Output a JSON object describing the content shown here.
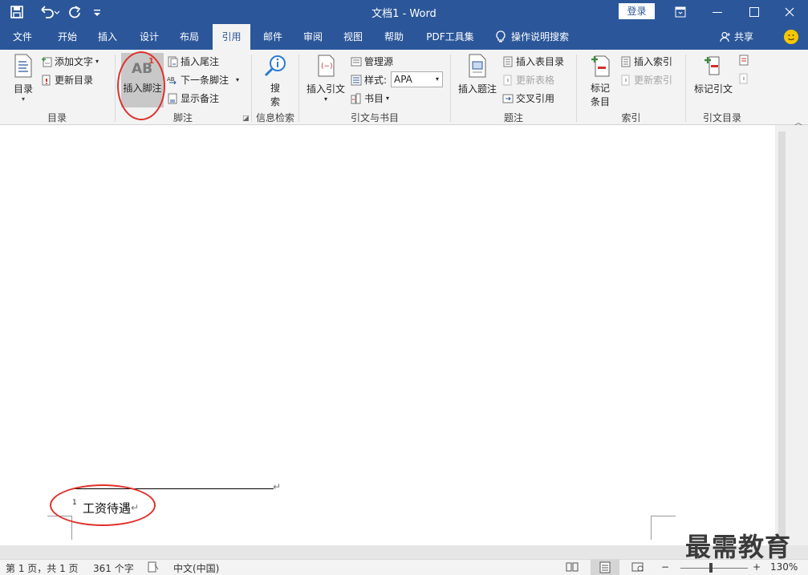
{
  "window": {
    "title": "文档1  -  Word",
    "login_label": "登录"
  },
  "tabs": [
    {
      "label": "文件"
    },
    {
      "label": "开始"
    },
    {
      "label": "插入"
    },
    {
      "label": "设计"
    },
    {
      "label": "布局"
    },
    {
      "label": "引用"
    },
    {
      "label": "邮件"
    },
    {
      "label": "审阅"
    },
    {
      "label": "视图"
    },
    {
      "label": "帮助"
    },
    {
      "label": "PDF工具集"
    }
  ],
  "active_tab": "引用",
  "tell_me": "操作说明搜索",
  "share": "共享",
  "ribbon": {
    "toc": {
      "big": "目录",
      "add_text": "添加文字",
      "update_toc": "更新目录",
      "label": "目录"
    },
    "footnotes": {
      "insert_footnote": "插入脚注",
      "icon_text": "AB",
      "icon_sup": "1",
      "insert_endnote": "插入尾注",
      "next_footnote": "下一条脚注",
      "show_notes": "显示备注",
      "label": "脚注"
    },
    "research": {
      "search_line1": "搜",
      "search_line2": "索",
      "label": "信息检索"
    },
    "citations": {
      "insert_citation": "插入引文",
      "manage_sources": "管理源",
      "style_label": "样式:",
      "style_value": "APA",
      "bibliography": "书目",
      "label": "引文与书目"
    },
    "captions": {
      "insert_caption": "插入题注",
      "insert_table_of_figures": "插入表目录",
      "update_table": "更新表格",
      "cross_reference": "交叉引用",
      "label": "题注"
    },
    "index": {
      "mark_entry_line1": "标记",
      "mark_entry_line2": "条目",
      "insert_index": "插入索引",
      "update_index": "更新索引",
      "label": "索引"
    },
    "toa": {
      "mark_citation": "标记引文",
      "label": "引文目录"
    }
  },
  "document": {
    "footnote_number": "1",
    "footnote_text": "工资待遇",
    "paragraph_mark": "↵"
  },
  "status": {
    "page": "第 1 页，共 1 页",
    "words": "361 个字",
    "language": "中文(中国)",
    "zoom_minus": "−",
    "zoom_plus": "+",
    "zoom": "130%"
  },
  "watermark": "最需教育",
  "colors": {
    "accent": "#2b579a",
    "annotation_circle": "#e0312b"
  }
}
